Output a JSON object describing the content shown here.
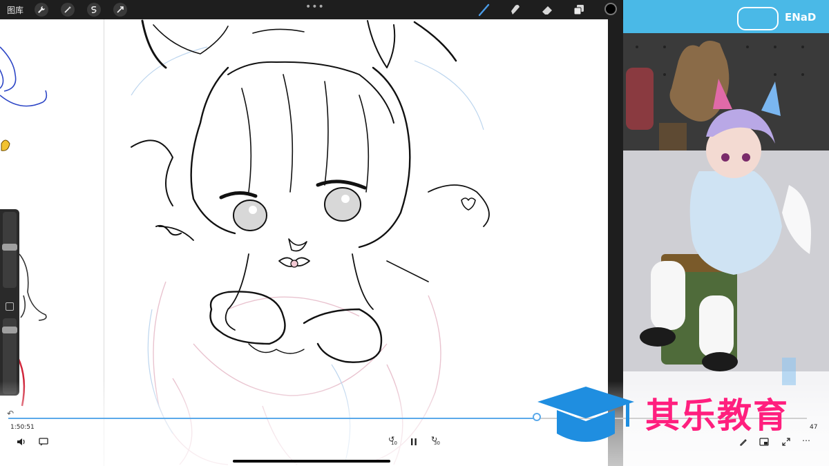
{
  "toolbar": {
    "gallery_label": "图库",
    "more_menu": "•••",
    "actions": [
      "wrench-icon",
      "magic-wand-icon",
      "selection-icon",
      "transform-icon"
    ],
    "tools": [
      "brush-icon",
      "smudge-icon",
      "eraser-icon",
      "layers-icon"
    ],
    "active_tool": "brush",
    "current_color": "#000000"
  },
  "video": {
    "current_time": "1:50:51",
    "end_time": "47",
    "progress": 0.66,
    "skip_back_label": "10",
    "skip_forward_label": "30"
  },
  "watermark": {
    "text": "其乐教育"
  },
  "webcam": {
    "brand": "ENaD"
  },
  "colors": {
    "accent": "#5aa9ea",
    "watermark_pink": "#ff1f7e",
    "watermark_blue": "#1f8ee0",
    "banner_blue": "#4ab9e7"
  }
}
